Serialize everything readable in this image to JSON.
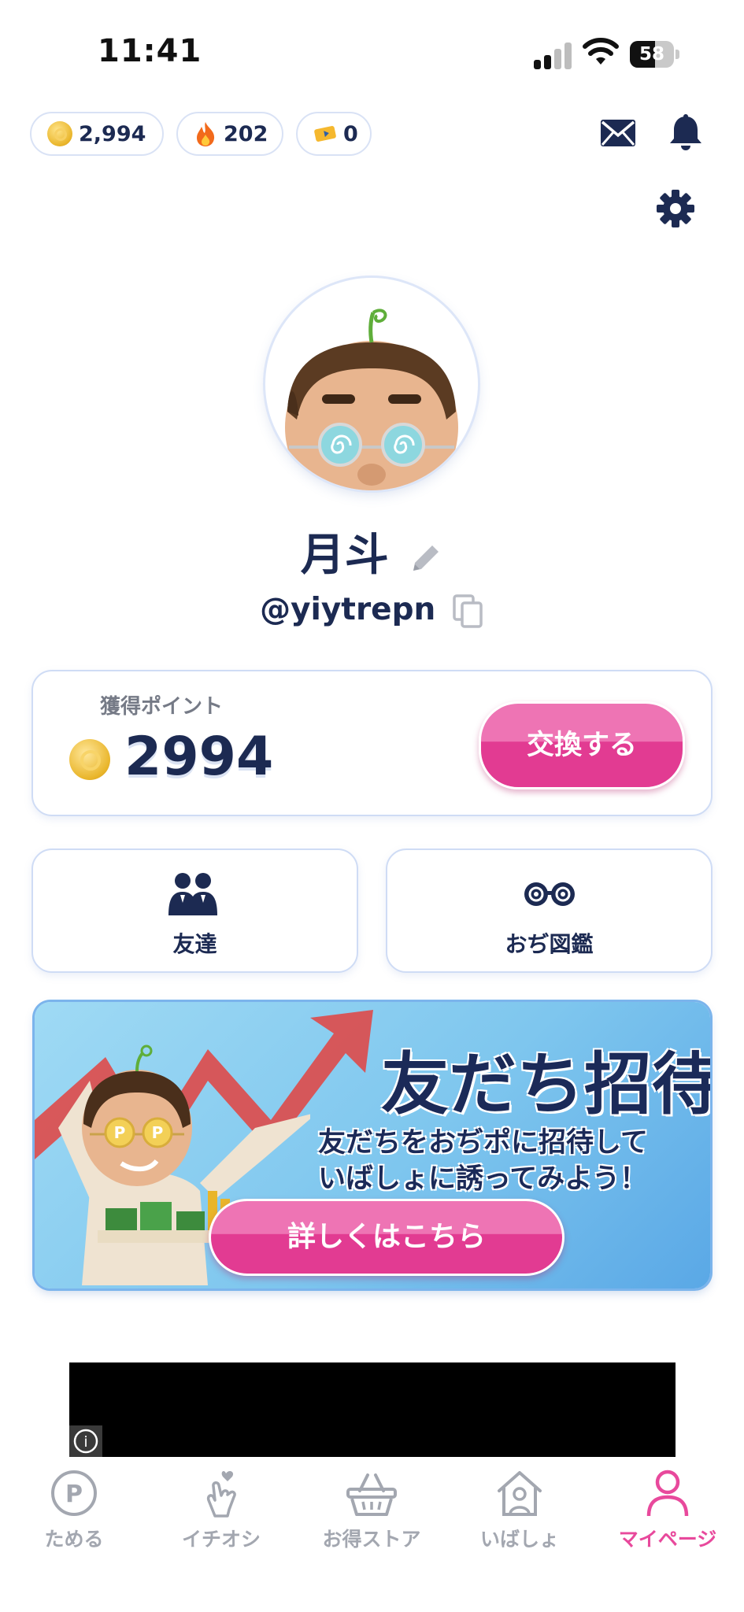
{
  "status_bar": {
    "time": "11:41",
    "battery": "58",
    "battery_level": 0.58
  },
  "currencies": [
    {
      "icon": "coin-icon",
      "value": "2,994"
    },
    {
      "icon": "fire-icon",
      "value": "202"
    },
    {
      "icon": "ticket-icon",
      "value": "0"
    }
  ],
  "header_icons": [
    "mail-icon",
    "bell-icon",
    "gear-icon"
  ],
  "profile": {
    "name": "月斗",
    "handle": "@yiytrepn"
  },
  "points": {
    "label": "獲得ポイント",
    "value": "2994",
    "exchange_label": "交換する"
  },
  "tiles": [
    {
      "icon": "friends-icon",
      "label": "友達"
    },
    {
      "icon": "glasses-icon",
      "label": "おぢ図鑑"
    }
  ],
  "banner": {
    "title": "友だち招待",
    "subtitle_line1": "友だちをおぢポに招待して",
    "subtitle_line2": "いばしょに誘ってみよう！",
    "button_label": "詳しくはこちら"
  },
  "ad": {
    "info_glyph": "i"
  },
  "tab_bar": {
    "items": [
      {
        "label": "ためる",
        "icon": "p-coin-icon",
        "active": false
      },
      {
        "label": "イチオシ",
        "icon": "finger-heart-icon",
        "active": false
      },
      {
        "label": "お得ストア",
        "icon": "basket-icon",
        "active": false
      },
      {
        "label": "いばしょ",
        "icon": "home-person-icon",
        "active": false
      },
      {
        "label": "マイページ",
        "icon": "person-icon",
        "active": true
      }
    ]
  },
  "colors": {
    "navy": "#1c2a52",
    "pink": "#e8499c",
    "gray": "#a3a7b0"
  }
}
